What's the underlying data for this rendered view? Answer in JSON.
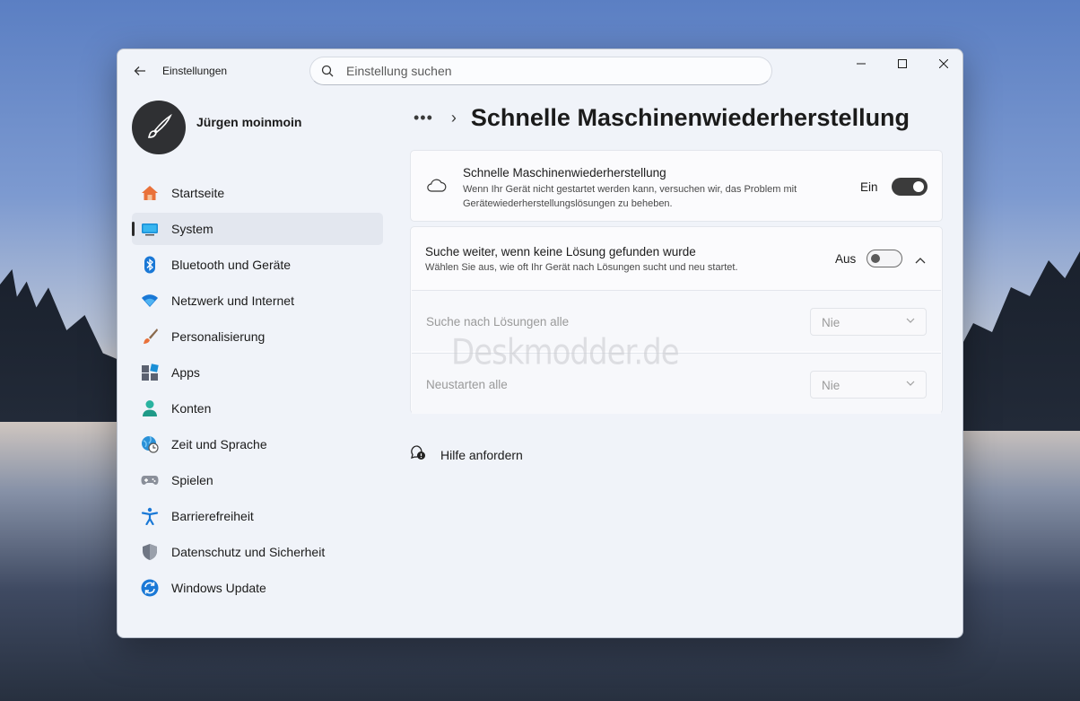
{
  "window": {
    "title": "Einstellungen",
    "search_placeholder": "Einstellung suchen"
  },
  "profile": {
    "name": "Jürgen moinmoin"
  },
  "nav": {
    "items": [
      {
        "label": "Startseite",
        "icon": "home-icon"
      },
      {
        "label": "System",
        "icon": "system-icon",
        "selected": true
      },
      {
        "label": "Bluetooth und Geräte",
        "icon": "bluetooth-icon"
      },
      {
        "label": "Netzwerk und Internet",
        "icon": "wifi-icon"
      },
      {
        "label": "Personalisierung",
        "icon": "brush-icon"
      },
      {
        "label": "Apps",
        "icon": "apps-icon"
      },
      {
        "label": "Konten",
        "icon": "account-icon"
      },
      {
        "label": "Zeit und Sprache",
        "icon": "time-language-icon"
      },
      {
        "label": "Spielen",
        "icon": "gamepad-icon"
      },
      {
        "label": "Barrierefreiheit",
        "icon": "accessibility-icon"
      },
      {
        "label": "Datenschutz und Sicherheit",
        "icon": "shield-icon"
      },
      {
        "label": "Windows Update",
        "icon": "update-icon"
      }
    ]
  },
  "breadcrumb": {
    "dots": "•••",
    "separator": "›",
    "title": "Schnelle Maschinenwiederherstellung"
  },
  "recovery_card": {
    "title": "Schnelle Maschinenwiederherstellung",
    "desc_line1": "Wenn Ihr Gerät nicht gestartet werden kann, versuchen wir, das Problem mit",
    "desc_line2": "Gerätewiederherstellungslösungen zu beheben.",
    "toggle_label": "Ein",
    "toggle_on": true
  },
  "continue_card": {
    "title": "Suche weiter, wenn keine Lösung gefunden wurde",
    "desc": "Wählen Sie aus, wie oft Ihr Gerät nach Lösungen sucht und neu startet.",
    "toggle_label": "Aus",
    "toggle_on": false,
    "rows": [
      {
        "label": "Suche nach Lösungen alle",
        "value": "Nie"
      },
      {
        "label": "Neustarten alle",
        "value": "Nie"
      }
    ]
  },
  "watermark": "Deskmodder.de",
  "help": {
    "label": "Hilfe anfordern"
  },
  "colors": {
    "accent_dark": "#3b3b3b",
    "window_bg": "#f0f3f9",
    "card_bg": "#fbfbfd"
  }
}
